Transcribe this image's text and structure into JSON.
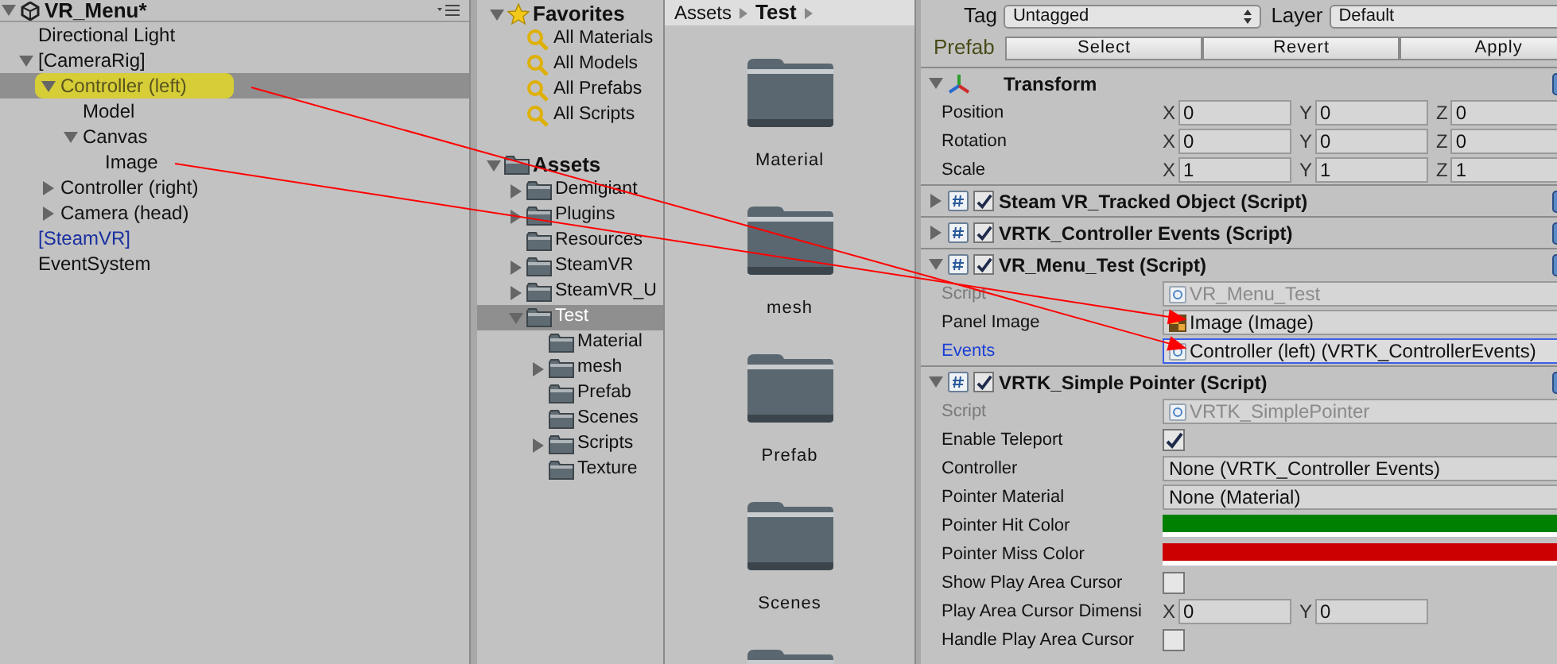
{
  "hierarchy": {
    "title": "VR_Menu*",
    "items": [
      {
        "label": "Directional Light",
        "kind": "object",
        "selected": false,
        "highlighted": false
      },
      {
        "label": "[CameraRig]",
        "kind": "object",
        "selected": false,
        "highlighted": false,
        "expanded": true,
        "children": [
          {
            "label": "Controller (left)",
            "kind": "object",
            "selected": true,
            "highlighted": true,
            "expanded": true,
            "children": [
              {
                "label": "Model",
                "kind": "object",
                "selected": false,
                "highlighted": false
              },
              {
                "label": "Canvas",
                "kind": "object",
                "selected": false,
                "highlighted": false,
                "expanded": true,
                "children": [
                  {
                    "label": "Image",
                    "kind": "object",
                    "selected": false,
                    "highlighted": false
                  }
                ]
              }
            ]
          },
          {
            "label": "Controller (right)",
            "kind": "object",
            "selected": false,
            "highlighted": false,
            "expanded": false
          },
          {
            "label": "Camera (head)",
            "kind": "object",
            "selected": false,
            "highlighted": false,
            "expanded": false
          }
        ]
      },
      {
        "label": "[SteamVR]",
        "kind": "prefab",
        "selected": false,
        "highlighted": false
      },
      {
        "label": "EventSystem",
        "kind": "object",
        "selected": false,
        "highlighted": false
      }
    ]
  },
  "project_tree": {
    "favorites": {
      "label": "Favorites",
      "items": [
        "All Materials",
        "All Models",
        "All Prefabs",
        "All Scripts"
      ]
    },
    "assets": {
      "label": "Assets",
      "expanded": true,
      "children": [
        {
          "label": "Demigiant",
          "selected": false,
          "expanded": false
        },
        {
          "label": "Plugins",
          "selected": false,
          "expanded": false
        },
        {
          "label": "Resources",
          "selected": false
        },
        {
          "label": "SteamVR",
          "selected": false,
          "expanded": false
        },
        {
          "label": "SteamVR_U",
          "selected": false,
          "expanded": false
        },
        {
          "label": "Test",
          "selected": true,
          "expanded": true,
          "children": [
            {
              "label": "Material",
              "selected": false
            },
            {
              "label": "mesh",
              "selected": false,
              "expanded": false
            },
            {
              "label": "Prefab",
              "selected": false
            },
            {
              "label": "Scenes",
              "selected": false
            },
            {
              "label": "Scripts",
              "selected": false,
              "expanded": false
            },
            {
              "label": "Texture",
              "selected": false
            }
          ]
        }
      ]
    }
  },
  "project_grid": {
    "breadcrumbs": [
      "Assets",
      "Test"
    ],
    "folders": [
      "Material",
      "mesh",
      "Prefab",
      "Scenes"
    ]
  },
  "inspector": {
    "tag_label": "Tag",
    "tag": "Untagged",
    "layer_label": "Layer",
    "layer": "Default",
    "prefab_label": "Prefab",
    "prefab_buttons": [
      "Select",
      "Revert",
      "Apply"
    ],
    "components": [
      {
        "kind": "transform",
        "title": "Transform",
        "expanded": true,
        "fields": [
          {
            "kind": "vector",
            "label": "Position",
            "selected": false,
            "axes": [
              {
                "axis": "X",
                "value": "0"
              },
              {
                "axis": "Y",
                "value": "0"
              },
              {
                "axis": "Z",
                "value": "0"
              }
            ]
          },
          {
            "kind": "vector",
            "label": "Rotation",
            "selected": false,
            "axes": [
              {
                "axis": "X",
                "value": "0"
              },
              {
                "axis": "Y",
                "value": "0"
              },
              {
                "axis": "Z",
                "value": "0"
              }
            ]
          },
          {
            "kind": "vector",
            "label": "Scale",
            "selected": false,
            "axes": [
              {
                "axis": "X",
                "value": "1"
              },
              {
                "axis": "Y",
                "value": "1"
              },
              {
                "axis": "Z",
                "value": "1"
              }
            ]
          }
        ]
      },
      {
        "kind": "script",
        "title": "Steam VR_Tracked Object (Script)",
        "enabled": true,
        "expanded": false
      },
      {
        "kind": "script",
        "title": "VRTK_Controller Events (Script)",
        "enabled": true,
        "expanded": false
      },
      {
        "kind": "script",
        "title": "VR_Menu_Test (Script)",
        "enabled": true,
        "expanded": true,
        "fields": [
          {
            "kind": "script",
            "label": "Script",
            "value": "VR_Menu_Test",
            "selected": false
          },
          {
            "kind": "image",
            "label": "Panel Image",
            "value": "Image (Image)",
            "selected": false
          },
          {
            "kind": "object",
            "label": "Events",
            "value": "Controller (left) (VRTK_ControllerEvents)",
            "selected": true
          }
        ]
      },
      {
        "kind": "script",
        "title": "VRTK_Simple Pointer (Script)",
        "enabled": true,
        "expanded": true,
        "fields": [
          {
            "kind": "script",
            "label": "Script",
            "value": "VRTK_SimplePointer",
            "selected": false
          },
          {
            "kind": "checkbox",
            "label": "Enable Teleport",
            "checked": true,
            "selected": false
          },
          {
            "kind": "text",
            "label": "Controller",
            "value": "None (VRTK_Controller Events)",
            "selected": false
          },
          {
            "kind": "text",
            "label": "Pointer Material",
            "value": "None (Material)",
            "selected": false
          },
          {
            "kind": "color",
            "label": "Pointer Hit Color",
            "color": "#008000",
            "selected": false
          },
          {
            "kind": "color",
            "label": "Pointer Miss Color",
            "color": "#cc0000",
            "selected": false
          },
          {
            "kind": "checkbox",
            "label": "Show Play Area Cursor",
            "checked": false,
            "selected": false
          },
          {
            "kind": "vector",
            "label": "Play Area Cursor Dimensi",
            "selected": false,
            "axes": [
              {
                "axis": "X",
                "value": "0"
              },
              {
                "axis": "Y",
                "value": "0"
              }
            ]
          },
          {
            "kind": "checkbox",
            "label": "Handle Play Area Cursor",
            "checked": false,
            "selected": false
          }
        ]
      }
    ]
  }
}
